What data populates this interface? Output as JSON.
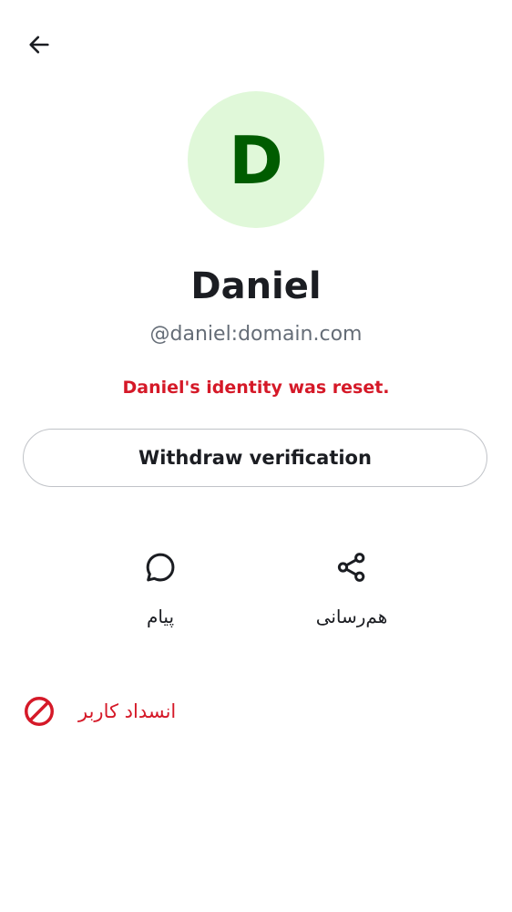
{
  "header": {
    "back_icon": "arrow-left-icon"
  },
  "profile": {
    "avatar_letter": "D",
    "avatar_bg": "#e0f8d9",
    "avatar_fg": "#005c00",
    "display_name": "Daniel",
    "user_id": "@daniel:domain.com",
    "warning": "Daniel's identity was reset."
  },
  "verification": {
    "withdraw_label": "Withdraw verification"
  },
  "actions": [
    {
      "label": "پیام",
      "icon": "chat-bubble-icon"
    },
    {
      "label": "هم‌رسانی",
      "icon": "share-icon"
    }
  ],
  "block": {
    "label": "انسداد کاربر",
    "icon": "block-icon",
    "color": "#d51928"
  }
}
